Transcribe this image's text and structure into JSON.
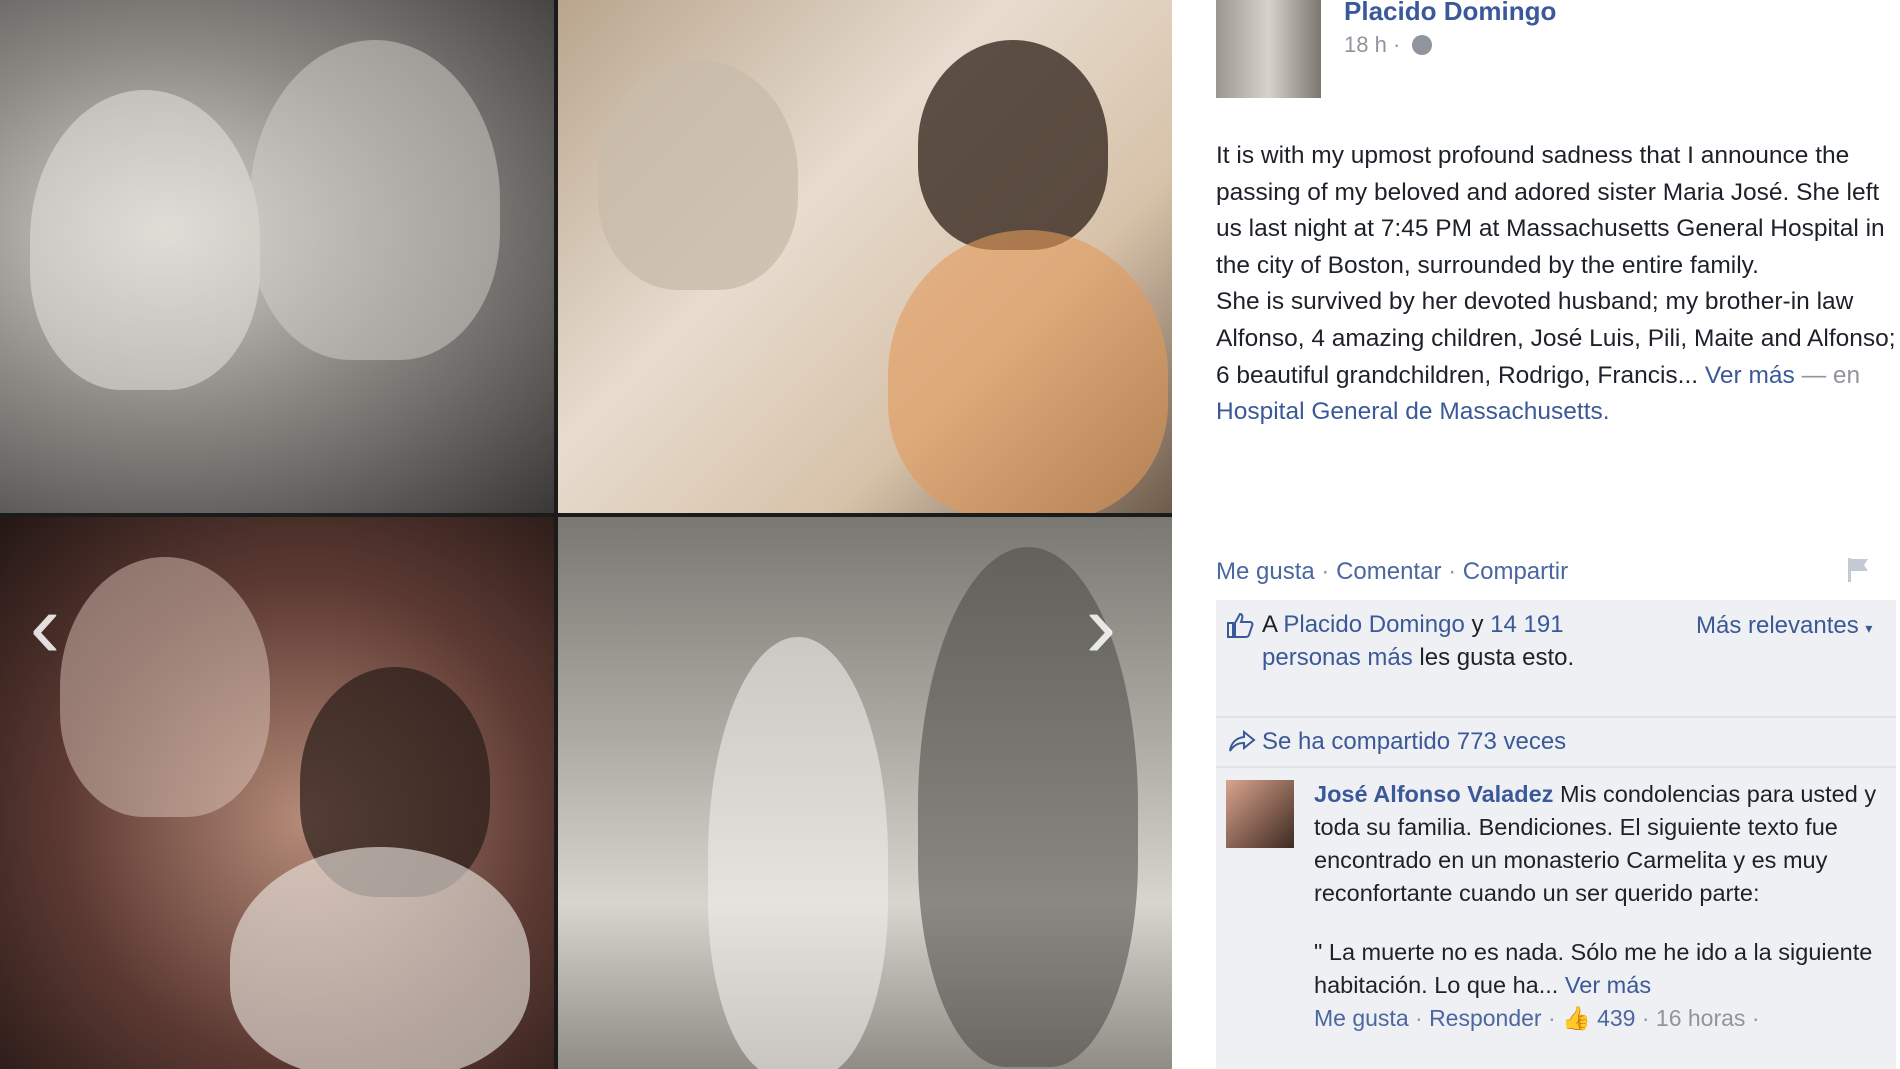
{
  "post": {
    "author": "Placido Domingo",
    "time": "18 h",
    "separator": "·",
    "text_p1": "It is with my upmost profound sadness that I announce the passing of my beloved and adored sister Maria José. She left us last night at 7:45 PM at Massachusetts General Hospital in the city of Boston, surrounded by the entire family.",
    "text_p2_start": "She is survived by her devoted husband; my brother-in law Alfonso, 4 amazing children, José Luis, Pili, Maite and Alfonso; 6 beautiful grandchildren, Rodrigo, Francis...",
    "see_more": "Ver más",
    "location_prefix": "— en",
    "location": "Hospital General de Massachusetts."
  },
  "actions": {
    "like": "Me gusta",
    "comment": "Comentar",
    "share": "Compartir",
    "separator": "·"
  },
  "likes": {
    "prefix": "A",
    "name": "Placido Domingo",
    "conjunction": "y",
    "others": "14 191 personas más",
    "suffix": "les gusta esto.",
    "sort": "Más relevantes"
  },
  "shares": {
    "text": "Se ha compartido 773 veces"
  },
  "comment": {
    "author": "José Alfonso Valadez",
    "text": "Mis condolencias para usted y toda su familia. Bendiciones. El siguiente texto fue encontrado en un monasterio Carmelita y es muy reconfortante cuando un ser querido parte:",
    "quote": "\" La muerte no es nada. Sólo me he ido a la siguiente habitación. Lo que ha...",
    "see_more": "Ver más",
    "like": "Me gusta",
    "reply": "Responder",
    "like_count": "439",
    "time": "16 horas",
    "separator": "·"
  },
  "gallery": {
    "prev_icon": "chevron-left-icon",
    "next_icon": "chevron-right-icon",
    "prev_glyph": "‹",
    "next_glyph": "›"
  },
  "colors": {
    "link": "#3b5998",
    "muted": "#90949c",
    "panel_bg": "#eff0f4"
  }
}
